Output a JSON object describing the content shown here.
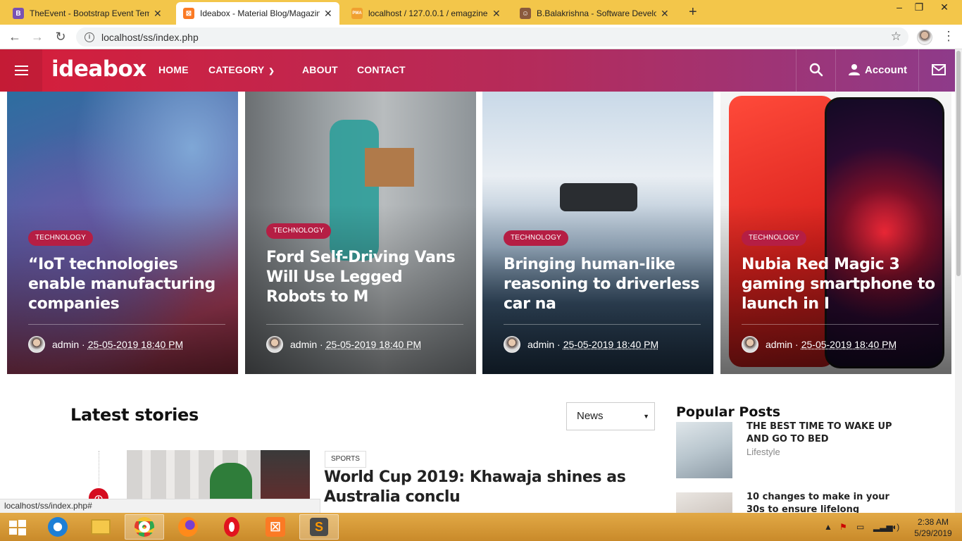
{
  "browser": {
    "tabs": [
      {
        "title": "TheEvent - Bootstrap Event Temp",
        "favicon": "B",
        "color": "#7952b3"
      },
      {
        "title": "Ideabox - Material Blog/Magazin",
        "favicon": "xampp",
        "color": "#fb7a24"
      },
      {
        "title": "localhost / 127.0.0.1 / emagzine",
        "favicon": "PMA",
        "color": "#f0a030"
      },
      {
        "title": "B.Balakrishna - Software Develop",
        "favicon": "person",
        "color": "#8a5a3c"
      }
    ],
    "url": "localhost/ss/index.php",
    "status_link": "localhost/ss/index.php#"
  },
  "site": {
    "logo": "ideabox",
    "nav": [
      {
        "label": "HOME"
      },
      {
        "label": "CATEGORY"
      },
      {
        "label": "ABOUT"
      },
      {
        "label": "CONTACT"
      }
    ],
    "account_label": "Account"
  },
  "hero": [
    {
      "category": "TECHNOLOGY",
      "title": "“IoT technologies enable manufacturing companies",
      "author": "admin",
      "date": "25-05-2019 18:40 PM"
    },
    {
      "category": "TECHNOLOGY",
      "title": "Ford Self-Driving Vans Will Use Legged Robots to M",
      "author": "admin",
      "date": "25-05-2019 18:40 PM"
    },
    {
      "category": "TECHNOLOGY",
      "title": "Bringing human-like reasoning to driverless car na",
      "author": "admin",
      "date": "25-05-2019 18:40 PM"
    },
    {
      "category": "TECHNOLOGY",
      "title": "Nubia Red Magic 3 gaming smartphone to launch in I",
      "author": "admin",
      "date": "25-05-2019 18:40 PM"
    }
  ],
  "latest": {
    "title": "Latest stories",
    "filter_value": "News",
    "story": {
      "category": "SPORTS",
      "title": "World Cup 2019: Khawaja shines as Australia conclu"
    }
  },
  "popular": {
    "title": "Popular Posts",
    "items": [
      {
        "title": "THE BEST TIME TO WAKE UP AND GO TO BED",
        "category": "Lifestyle"
      },
      {
        "title": "10 changes to make in your 30s to ensure lifelong"
      }
    ]
  },
  "taskbar": {
    "time": "2:38 AM",
    "date": "5/29/2019"
  },
  "colors": {
    "brand_red": "#d51e3a",
    "brand_purple": "#8e3b8a",
    "badge": "#b51e44"
  }
}
